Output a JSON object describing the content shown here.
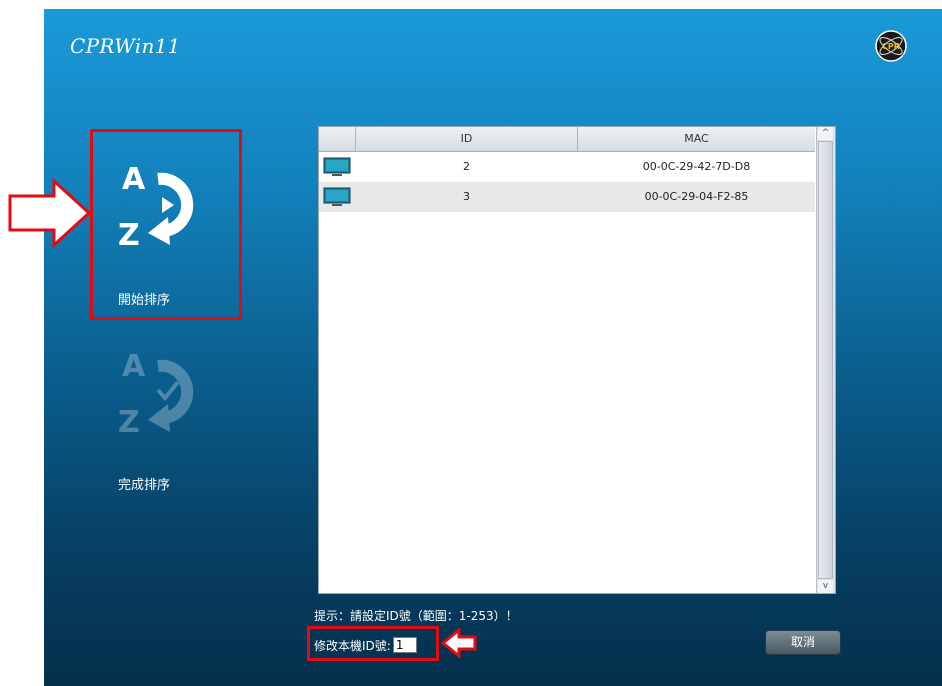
{
  "app": {
    "title": "CPRWin11",
    "logo_text": "CPR"
  },
  "actions": {
    "start_sort": {
      "label": "開始排序",
      "icon": "sort-a-z-play-icon"
    },
    "finish_sort": {
      "label": "完成排序",
      "icon": "sort-a-z-check-icon"
    }
  },
  "table": {
    "columns": [
      "",
      "ID",
      "MAC"
    ],
    "rows": [
      {
        "icon": "monitor-icon",
        "id": "2",
        "mac": "00-0C-29-42-7D-D8"
      },
      {
        "icon": "monitor-icon",
        "id": "3",
        "mac": "00-0C-29-04-F2-85"
      }
    ],
    "scroll_up": "^",
    "scroll_down": "v"
  },
  "footer": {
    "hint": "提示：請設定ID號（範圍：1-253）！",
    "id_label": "修改本機ID號:",
    "id_value": "1",
    "cancel_label": "取消"
  },
  "colors": {
    "background_top": "#1a9ad8",
    "background_bottom": "#04304c",
    "highlight": "#e30a12"
  }
}
